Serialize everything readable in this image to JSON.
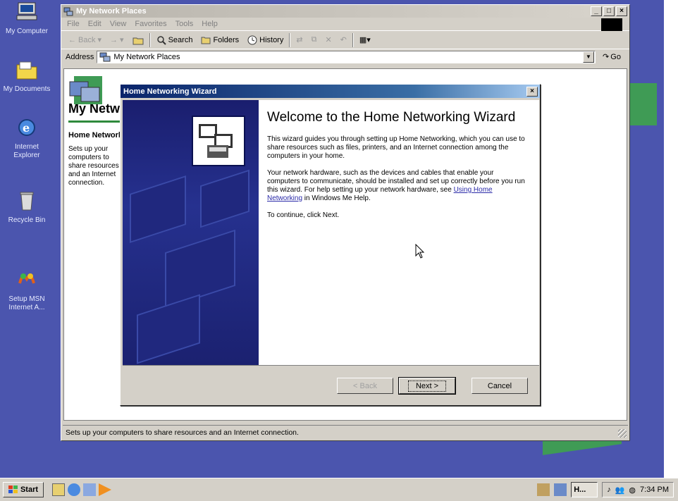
{
  "desktop": {
    "icons": [
      {
        "label": "My Computer",
        "icon": "my-computer-icon"
      },
      {
        "label": "My Documents",
        "icon": "my-documents-icon"
      },
      {
        "label": "Internet Explorer",
        "icon": "internet-explorer-icon"
      },
      {
        "label": "Recycle Bin",
        "icon": "recycle-bin-icon"
      },
      {
        "label": "Setup MSN Internet A...",
        "icon": "msn-setup-icon"
      }
    ]
  },
  "explorer": {
    "title": "My Network Places",
    "menu": [
      "File",
      "Edit",
      "View",
      "Favorites",
      "Tools",
      "Help"
    ],
    "toolbar": {
      "back": "Back",
      "search": "Search",
      "folders": "Folders",
      "history": "History"
    },
    "address_label": "Address",
    "address_value": "My Network Places",
    "go_label": "Go",
    "left_panel": {
      "title": "My Network Places",
      "subtitle": "Home Networking Wizard",
      "description": "Sets up your computers to share resources and an Internet connection."
    },
    "status_text": "Sets up your computers to share resources and an Internet connection."
  },
  "wizard": {
    "title": "Home Networking Wizard",
    "heading": "Welcome to the Home Networking Wizard",
    "para1": "This wizard guides you through setting up Home Networking, which you can use to share resources such as files, printers, and an Internet connection among the computers in your home.",
    "para2_before": "Your network hardware, such as the devices and cables that enable your computers to communicate, should be installed and set up correctly before you run this wizard. For help setting up your network hardware, see ",
    "para2_link": "Using Home Networking",
    "para2_after": " in Windows Me Help.",
    "para3": "To continue, click Next.",
    "back_label": "< Back",
    "next_label": "Next >",
    "cancel_label": "Cancel"
  },
  "taskbar": {
    "start_label": "Start",
    "task_label": "H...",
    "clock": "7:34 PM"
  },
  "colors": {
    "desktop": "#4b55ae",
    "title_active": "#0a246a",
    "wizard_side": "#1a1e6e",
    "green_accent": "#3f9b55"
  }
}
